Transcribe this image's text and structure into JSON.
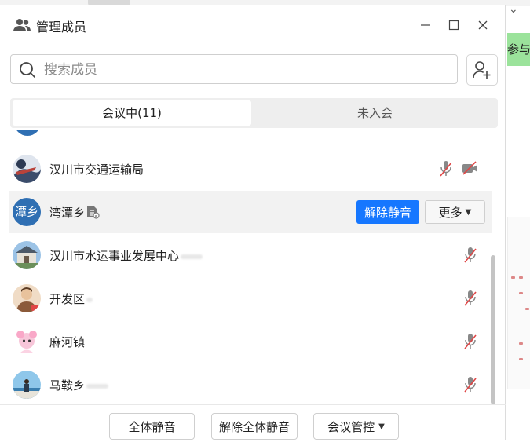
{
  "dialog": {
    "title": "管理成员",
    "search": {
      "placeholder": "搜索成员",
      "value": ""
    },
    "tabs": [
      {
        "label": "会议中(11)",
        "active": true
      },
      {
        "label": "未入会",
        "active": false
      }
    ]
  },
  "members": [
    {
      "name": "汉川市交通运输局",
      "avatar_text": "",
      "mic": "muted",
      "camera": "off",
      "highlighted": false
    },
    {
      "name": "湾潭乡",
      "avatar_text": "潭乡",
      "badge": "doc-icon",
      "highlighted": true,
      "unmute_label": "解除静音",
      "more_label": "更多"
    },
    {
      "name": "汉川市水运事业发展中心",
      "avatar_text": "",
      "mic": "muted",
      "highlighted": false
    },
    {
      "name": "开发区",
      "avatar_text": "",
      "mic": "muted",
      "highlighted": false
    },
    {
      "name": "麻河镇",
      "avatar_text": "",
      "mic": "muted",
      "highlighted": false
    },
    {
      "name": "马鞍乡",
      "avatar_text": "",
      "mic": "muted",
      "highlighted": false
    }
  ],
  "footer": {
    "mute_all": "全体静音",
    "unmute_all": "解除全体静音",
    "meeting_control": "会议管控"
  },
  "background": {
    "right_text": "参与"
  },
  "colors": {
    "primary": "#1677ff",
    "avatar_blue": "#2f6fb3",
    "muted_red": "#e04646"
  }
}
